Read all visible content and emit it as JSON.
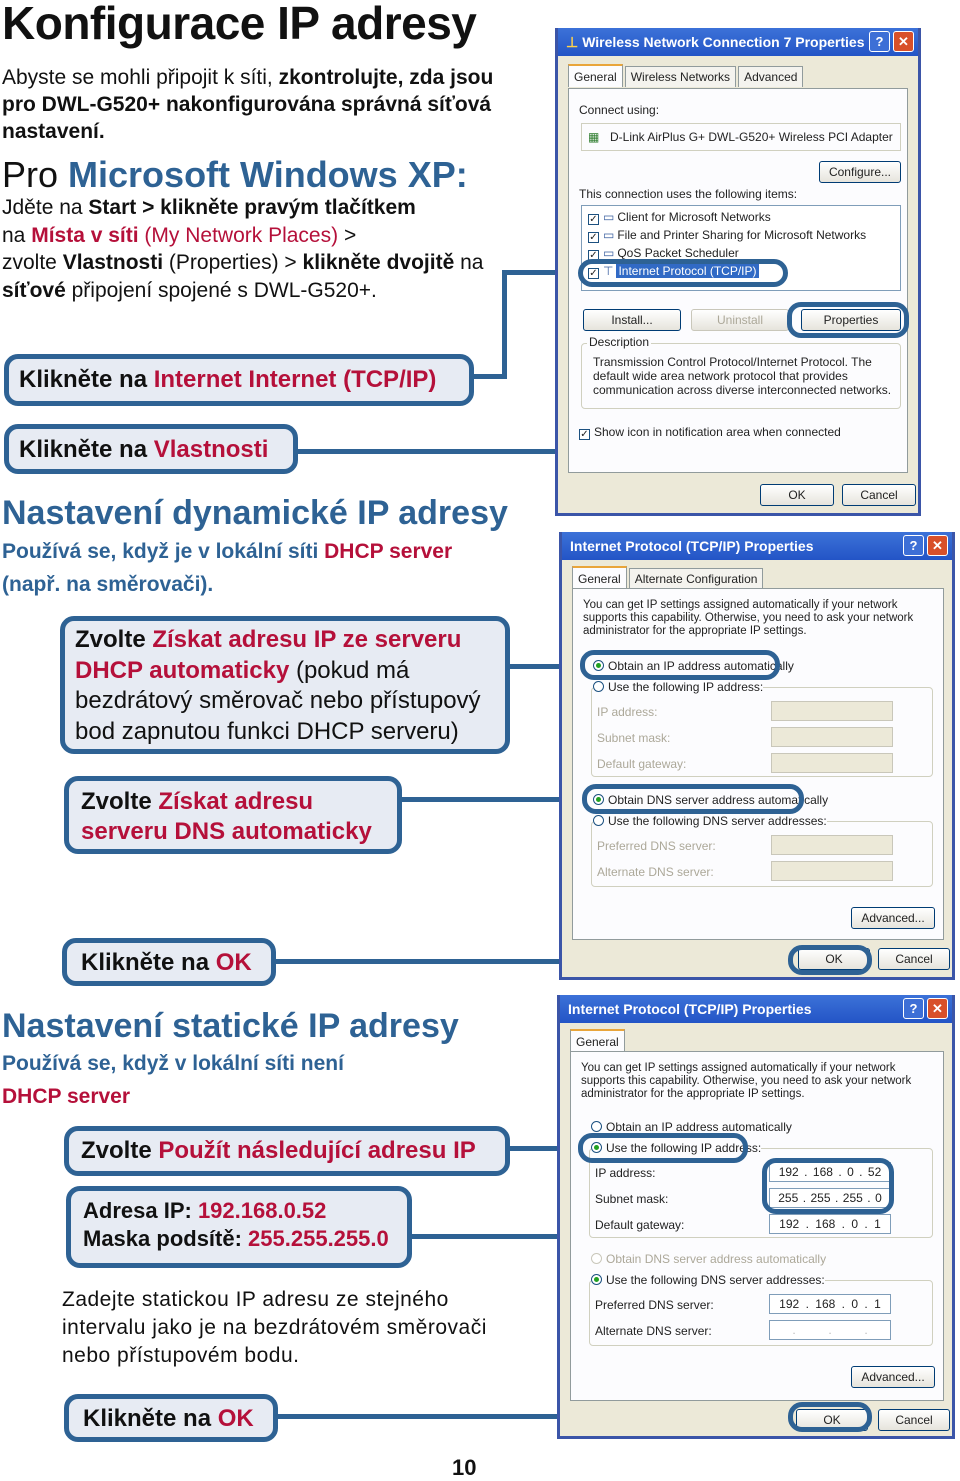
{
  "page": {
    "title": "Konfigurace IP adresy",
    "intro": {
      "part1": "Abyste se mohli připojit k síti, ",
      "part2": "zkontrolujte, zda jsou pro DWL-G520+ nakonfigurována správná síťová nastavení."
    },
    "xp_heading": {
      "prefix": "Pro ",
      "highlight": "Microsoft Windows XP:"
    },
    "xp_text": {
      "s1": "Jděte na ",
      "s2": "Start > klikněte pravým tlačítkem",
      "s3": "na ",
      "s4": "Místa v síti",
      "s5": " (My Network Places)",
      "s6": " > ",
      "s7": "zvolte ",
      "s8": "Vlastnosti",
      "s9": " (Properties) > ",
      "s10": "klikněte dvojitě",
      "s11": " na ",
      "s12": "síťové",
      "s13": " připojení spojené s DWL-G520+."
    },
    "page_number": "10"
  },
  "callouts": {
    "tcpip": {
      "black": "Klikněte na ",
      "red": "Internet Internet (TCP/IP)"
    },
    "properties": {
      "black": "Klikněte na ",
      "red": "Vlastnosti"
    },
    "dhcp_ip": {
      "black": "Zvolte ",
      "red": "Získat adresu IP ze serveru DHCP automaticky",
      "rest": "  (pokud má bezdrátový směrovač nebo přístupový bod zapnutou funkci DHCP serveru)"
    },
    "dhcp_dns": {
      "black": "Zvolte ",
      "red": "Získat adresu serveru DNS automaticky"
    },
    "ok1": {
      "black": "Klikněte na ",
      "red": "OK"
    },
    "static_ip": {
      "black": "Zvolte ",
      "red": "Použít následující adresu IP"
    },
    "address": {
      "ip_label": "Adresa IP: ",
      "ip_value": "192.168.0.52",
      "mask_label": "Maska podsítě: ",
      "mask_value": "255.255.255.0"
    },
    "ok2": {
      "black": "Klikněte na ",
      "red": "OK"
    }
  },
  "sections": {
    "dynamic": {
      "heading": "Nastavení dynamické IP adresy",
      "sub_blue": "Používá se, když je v lokální síti ",
      "sub_red": "DHCP server",
      "sub_blue2": "(např. na směrovači)."
    },
    "static": {
      "heading": "Nastavení statické IP adresy",
      "sub_blue": "Používá se, když v lokální síti není",
      "sub_red": "DHCP server",
      "note": "Zadejte statickou IP adresu ze stejného intervalu jako je na bezdrátovém směrovači nebo přístupovém bodu."
    }
  },
  "dialog1": {
    "title": "Wireless Network Connection 7 Properties",
    "title_icon": "network-connection-icon",
    "tabs": [
      "General",
      "Wireless Networks",
      "Advanced"
    ],
    "connect_using_label": "Connect using:",
    "adapter": "D-Link AirPlus G+ DWL-G520+ Wireless PCI Adapter",
    "configure": "Configure...",
    "items_label": "This connection uses the following items:",
    "items": [
      {
        "label": "Client for Microsoft Networks",
        "checked": true,
        "icon": "computer-icon"
      },
      {
        "label": "File and Printer Sharing for Microsoft Networks",
        "checked": true,
        "icon": "printer-icon"
      },
      {
        "label": "QoS Packet Scheduler",
        "checked": true,
        "icon": "computer-icon"
      },
      {
        "label": "Internet Protocol (TCP/IP)",
        "checked": true,
        "icon": "protocol-icon",
        "selected": true
      }
    ],
    "install": "Install...",
    "uninstall": "Uninstall",
    "properties": "Properties",
    "description_label": "Description",
    "description": "Transmission Control Protocol/Internet Protocol. The default wide area network protocol that provides communication across diverse interconnected networks.",
    "show_icon": "Show icon in notification area when connected",
    "ok": "OK",
    "cancel": "Cancel"
  },
  "dialog2": {
    "title": "Internet Protocol (TCP/IP) Properties",
    "tabs": [
      "General",
      "Alternate Configuration"
    ],
    "intro": "You can get IP settings assigned automatically if your network supports this capability. Otherwise, you need to ask your network administrator for the appropriate IP settings.",
    "obtain_ip": "Obtain an IP address automatically",
    "use_ip": "Use the following IP address:",
    "ip_address": "IP address:",
    "subnet_mask": "Subnet mask:",
    "default_gateway": "Default gateway:",
    "obtain_dns": "Obtain DNS server address automatically",
    "use_dns": "Use the following DNS server addresses:",
    "preferred_dns": "Preferred DNS server:",
    "alternate_dns": "Alternate DNS server:",
    "advanced": "Advanced...",
    "ok": "OK",
    "cancel": "Cancel"
  },
  "dialog3": {
    "title": "Internet Protocol (TCP/IP) Properties",
    "tabs": [
      "General"
    ],
    "intro": "You can get IP settings assigned automatically if your network supports this capability. Otherwise, you need to ask your network administrator for the appropriate IP settings.",
    "obtain_ip": "Obtain an IP address automatically",
    "use_ip": "Use the following IP address:",
    "ip_address": "IP address:",
    "ip_value": [
      "192",
      "168",
      "0",
      "52"
    ],
    "subnet_mask": "Subnet mask:",
    "mask_value": [
      "255",
      "255",
      "255",
      "0"
    ],
    "default_gateway": "Default gateway:",
    "gateway_value": [
      "192",
      "168",
      "0",
      "1"
    ],
    "obtain_dns": "Obtain DNS server address automatically",
    "use_dns": "Use the following DNS server addresses:",
    "preferred_dns": "Preferred DNS server:",
    "preferred_value": [
      "192",
      "168",
      "0",
      "1"
    ],
    "alternate_dns": "Alternate DNS server:",
    "advanced": "Advanced...",
    "ok": "OK",
    "cancel": "Cancel"
  },
  "colors": {
    "accent_blue": "#2e6294",
    "accent_red": "#b5103a",
    "callout_bg": "#e7ebf3"
  }
}
